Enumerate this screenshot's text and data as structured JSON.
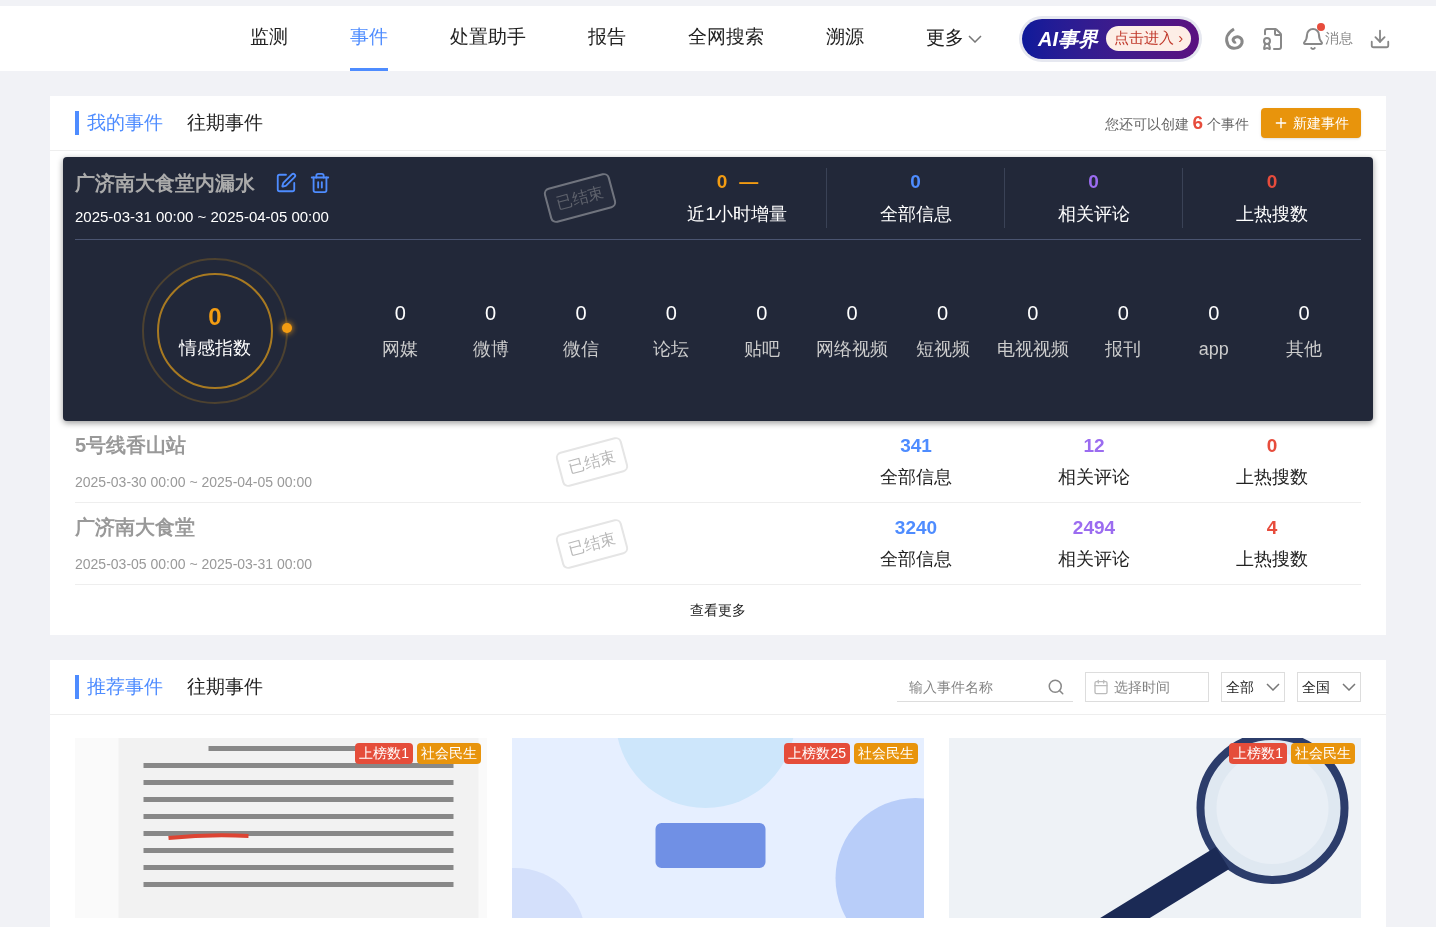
{
  "nav": {
    "items": [
      {
        "label": "监测",
        "selected": false
      },
      {
        "label": "事件",
        "selected": true
      },
      {
        "label": "处置助手",
        "selected": false
      },
      {
        "label": "报告",
        "selected": false
      },
      {
        "label": "全网搜索",
        "selected": false
      },
      {
        "label": "溯源",
        "selected": false
      }
    ],
    "more": "更多",
    "ai_banner": {
      "brand": "AI事界",
      "action": "点击进入",
      "arrow": "›"
    },
    "messages": {
      "label": "消息",
      "unread": true
    }
  },
  "my_events": {
    "tabs": [
      {
        "label": "我的事件",
        "selected": true
      },
      {
        "label": "往期事件",
        "selected": false
      }
    ],
    "quota": {
      "prefix": "您还可以创建",
      "count": "6",
      "suffix": "个事件"
    },
    "new_button": "新建事件",
    "featured": {
      "title": "广济南大食堂内漏水",
      "range": "2025-03-31 00:00 ~ 2025-04-05 00:00",
      "status": "已结束",
      "stats": [
        {
          "value": "0",
          "label": "近1小时增量",
          "color": "#f39c12",
          "trend": "—"
        },
        {
          "value": "0",
          "label": "全部信息",
          "color": "#4e8cff"
        },
        {
          "value": "0",
          "label": "相关评论",
          "color": "#9b6cf0"
        },
        {
          "value": "0",
          "label": "上热搜数",
          "color": "#e74c3c"
        }
      ],
      "sentiment": {
        "value": "0",
        "label": "情感指数"
      },
      "channels": [
        {
          "value": "0",
          "label": "网媒"
        },
        {
          "value": "0",
          "label": "微博"
        },
        {
          "value": "0",
          "label": "微信"
        },
        {
          "value": "0",
          "label": "论坛"
        },
        {
          "value": "0",
          "label": "贴吧"
        },
        {
          "value": "0",
          "label": "网络视频"
        },
        {
          "value": "0",
          "label": "短视频"
        },
        {
          "value": "0",
          "label": "电视视频"
        },
        {
          "value": "0",
          "label": "报刊"
        },
        {
          "value": "0",
          "label": "app"
        },
        {
          "value": "0",
          "label": "其他"
        }
      ]
    },
    "events": [
      {
        "title": "5号线香山站",
        "range": "2025-03-30 00:00 ~ 2025-04-05 00:00",
        "status": "已结束",
        "stats": [
          {
            "value": "341",
            "label": "全部信息",
            "color": "#4e8cff"
          },
          {
            "value": "12",
            "label": "相关评论",
            "color": "#9b6cf0"
          },
          {
            "value": "0",
            "label": "上热搜数",
            "color": "#e74c3c"
          }
        ]
      },
      {
        "title": "广济南大食堂",
        "range": "2025-03-05 00:00 ~ 2025-03-31 00:00",
        "status": "已结束",
        "stats": [
          {
            "value": "3240",
            "label": "全部信息",
            "color": "#4e8cff"
          },
          {
            "value": "2494",
            "label": "相关评论",
            "color": "#9b6cf0"
          },
          {
            "value": "4",
            "label": "上热搜数",
            "color": "#e74c3c"
          }
        ]
      }
    ],
    "more": "查看更多"
  },
  "recommended": {
    "tabs": [
      {
        "label": "推荐事件",
        "selected": true
      },
      {
        "label": "往期事件",
        "selected": false
      }
    ],
    "search_placeholder": "输入事件名称",
    "date_placeholder": "选择时间",
    "selects": [
      "全部",
      "全国"
    ],
    "cards": [
      {
        "rank": "上榜数1",
        "category": "社会民生"
      },
      {
        "rank": "上榜数25",
        "category": "社会民生"
      },
      {
        "rank": "上榜数1",
        "category": "社会民生"
      }
    ]
  }
}
